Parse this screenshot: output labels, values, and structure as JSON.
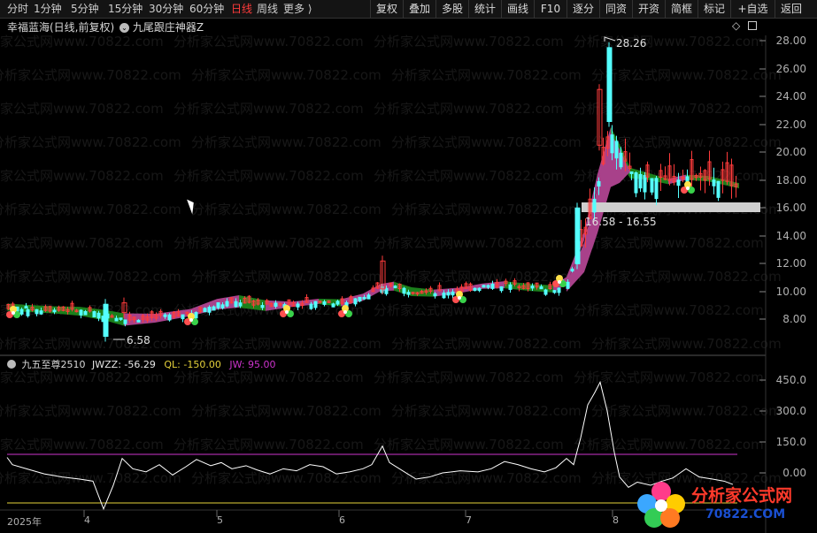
{
  "toolbar": {
    "timeframes": [
      "分时",
      "1分钟",
      "5分钟",
      "15分钟",
      "30分钟",
      "60分钟",
      "日线",
      "周线",
      "更多 ⟩"
    ],
    "active_timeframe": "日线",
    "buttons": [
      "复权",
      "叠加",
      "多股",
      "统计",
      "画线",
      "F10",
      "逐分",
      "同资",
      "开资",
      "简框",
      "标记",
      "+自选",
      "返回"
    ]
  },
  "main_chart": {
    "title": "幸福蓝海(日线,前复权)",
    "indicator_name": "九尾跟庄神器Z",
    "price_axis": [
      "28.00",
      "26.00",
      "24.00",
      "22.00",
      "20.00",
      "18.00",
      "16.00",
      "14.00",
      "12.00",
      "10.00",
      "8.00"
    ],
    "high_label": "28.26",
    "low_label": "6.58",
    "band_label": "16.58 - 16.55"
  },
  "sub_chart": {
    "name": "九五至尊2510",
    "jwzz": {
      "label": "JWZZ:",
      "value": "-56.29"
    },
    "ql": {
      "label": "QL:",
      "value": "-150.00"
    },
    "jw": {
      "label": "JW:",
      "value": "95.00"
    },
    "axis": [
      "450.0",
      "300.0",
      "150.0",
      "0.00"
    ]
  },
  "date_axis": [
    "2025年",
    "4",
    "5",
    "6",
    "7",
    "8"
  ],
  "watermark": "分析家公式网www.70822.com",
  "logo": {
    "name": "分析家公式网",
    "url": "70822.COM"
  },
  "colors": {
    "up": "#ff3b3b",
    "down": "#54ffff",
    "band_up": "#a8418a",
    "band_down": "#1b7f1b",
    "jw_line": "#cc33cc",
    "ql_line": "#e6d23a"
  }
}
